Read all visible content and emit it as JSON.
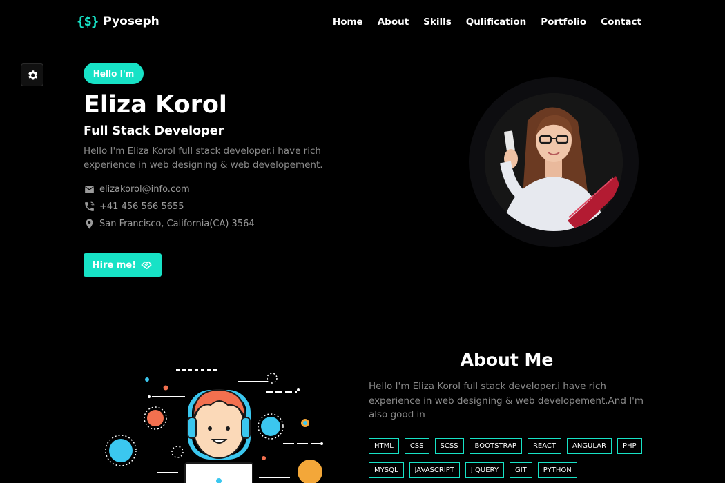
{
  "brand": {
    "mark": "{$}",
    "name": "Pyoseph"
  },
  "nav": [
    {
      "label": "Home"
    },
    {
      "label": "About"
    },
    {
      "label": "Skills"
    },
    {
      "label": "Qulification"
    },
    {
      "label": "Portfolio"
    },
    {
      "label": "Contact"
    }
  ],
  "settings": {
    "icon": "gear-icon"
  },
  "hero": {
    "badge": "Hello I'm",
    "name": "Eliza Korol",
    "role": "Full Stack Developer",
    "description": "Hello I'm Eliza Korol full stack developer.i have rich experience in web designing & web developement.",
    "contacts": [
      {
        "icon": "mail-icon",
        "text": "elizakorol@info.com"
      },
      {
        "icon": "phone-icon",
        "text": "+41 456 566 5655"
      },
      {
        "icon": "location-pin-icon",
        "text": "San Francisco, California(CA) 3564"
      }
    ],
    "hire_label": "Hire me!",
    "hire_icon": "hand-shake-icon"
  },
  "about": {
    "title": "About Me",
    "description": "Hello I'm Eliza Korol full stack developer.i have rich experience in web designing & web developement.And I'm also good in",
    "skills": [
      "HTML",
      "CSS",
      "SCSS",
      "BOOTSTRAP",
      "REACT",
      "ANGULAR",
      "PHP",
      "MYSQL",
      "JAVASCRIPT",
      "J QUERY",
      "GIT",
      "PYTHON"
    ]
  },
  "colors": {
    "accent": "#17e2c6",
    "background": "#000000",
    "muted_text": "#8a8a8a"
  }
}
